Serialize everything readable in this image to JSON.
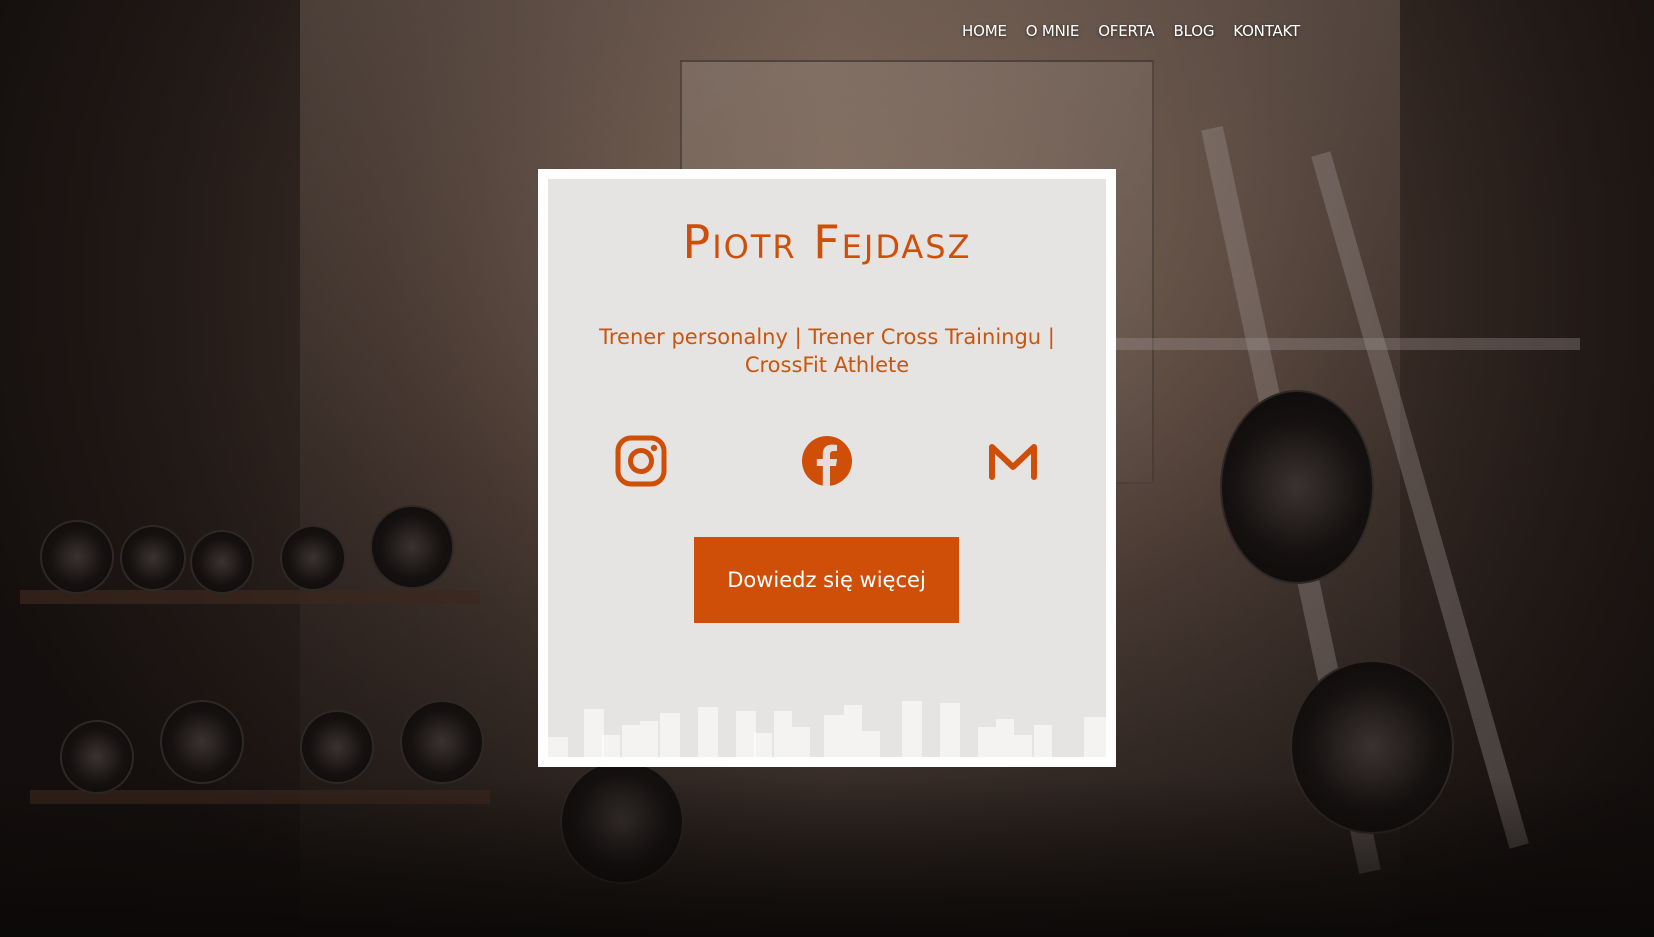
{
  "nav": {
    "items": [
      "HOME",
      "O MNIE",
      "OFERTA",
      "BLOG",
      "KONTAKT"
    ]
  },
  "hero": {
    "title": "Piotr Fejdasz",
    "subtitle": "Trener personalny | Trener Cross Trainingu | CrossFit Athlete",
    "cta_label": "Dowiedz się więcej",
    "social_icons": [
      "instagram-icon",
      "facebook-icon",
      "gmail-icon"
    ]
  },
  "colors": {
    "accent": "#cf4f08",
    "nav_text": "#ffffff",
    "card_bg": "#e1dedc",
    "card_frame": "#ffffff"
  }
}
